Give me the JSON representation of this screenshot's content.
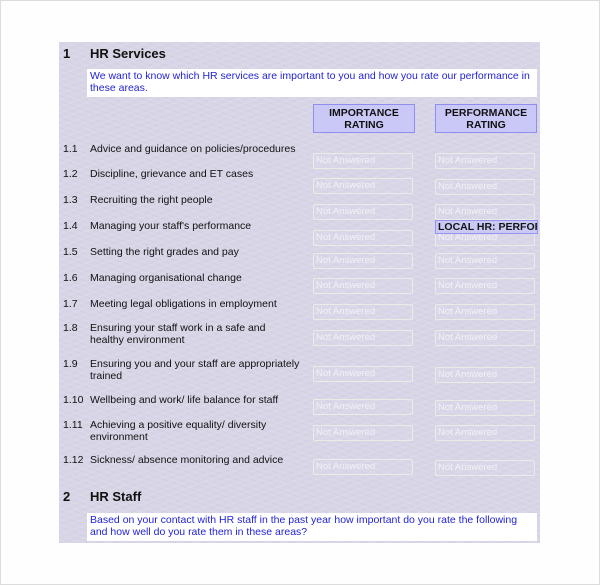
{
  "section1": {
    "number": "1",
    "title": "HR Services",
    "intro": "We want to know which HR services are important to you and how you rate our performance in these areas.",
    "importance_header": "IMPORTANCE RATING",
    "performance_header": "PERFORMANCE RATING",
    "placeholder": "Not Answered",
    "items": [
      {
        "num": "1.1",
        "label": "Advice and guidance on policies/procedures",
        "importance": "Not Answered",
        "performance": "Not Answered"
      },
      {
        "num": "1.2",
        "label": "Discipline, grievance and ET cases",
        "importance": "Not Answered",
        "performance": "Not Answered"
      },
      {
        "num": "1.3",
        "label": "Recruiting the right people",
        "importance": "Not Answered",
        "performance": "Not Answered"
      },
      {
        "num": "1.4",
        "label": "Managing your staff's performance",
        "importance": "Not Answered",
        "performance": "Not Answered"
      },
      {
        "num": "1.5",
        "label": "Setting the right grades and pay",
        "importance": "Not Answered",
        "performance": "Not Answered"
      },
      {
        "num": "1.6",
        "label": "Managing organisational change",
        "importance": "Not Answered",
        "performance": "Not Answered"
      },
      {
        "num": "1.7",
        "label": "Meeting legal obligations in employment",
        "importance": "Not Answered",
        "performance": "Not Answered"
      },
      {
        "num": "1.8",
        "label": "Ensuring your staff work in a safe and healthy environment",
        "importance": "Not Answered",
        "performance": "Not Answered"
      },
      {
        "num": "1.9",
        "label": "Ensuring you and your staff are appropriately trained",
        "importance": "Not Answered",
        "performance": "Not Answered"
      },
      {
        "num": "1.10",
        "label": "Wellbeing and work/ life balance for staff",
        "importance": "Not Answered",
        "performance": "Not Answered"
      },
      {
        "num": "1.11",
        "label": "Achieving a positive equality/ diversity environment",
        "importance": "Not Answered",
        "performance": "Not Answered"
      },
      {
        "num": "1.12",
        "label": "Sickness/ absence monitoring and advice",
        "importance": "Not Answered",
        "performance": "Not Answered"
      }
    ],
    "overlay_label": "LOCAL HR: PERFOR"
  },
  "section2": {
    "number": "2",
    "title": "HR Staff",
    "intro": "Based on your contact with HR staff in the past year how important do you rate the following and how well do you rate them in these areas?"
  }
}
